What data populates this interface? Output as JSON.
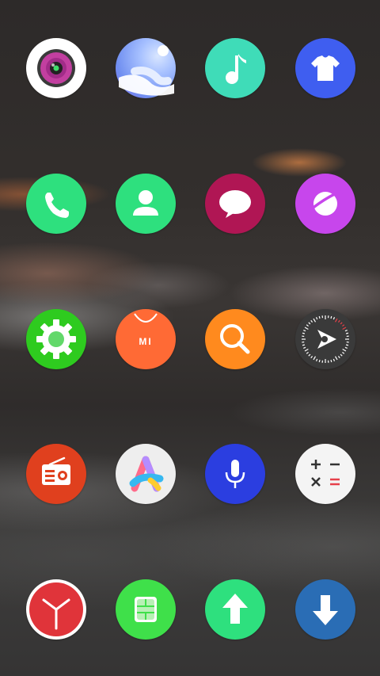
{
  "screen": "home-screen-icon-grid",
  "apps": [
    {
      "id": "camera",
      "icon": "camera-icon",
      "bg": "#ffffff"
    },
    {
      "id": "gallery",
      "icon": "gallery-icon",
      "bg": "#7fa4f5"
    },
    {
      "id": "music",
      "icon": "music-note-icon",
      "bg": "#3fdcb8"
    },
    {
      "id": "themes",
      "icon": "tshirt-icon",
      "bg": "#3f5ef0"
    },
    {
      "id": "phone",
      "icon": "phone-icon",
      "bg": "#2ee07e"
    },
    {
      "id": "contacts",
      "icon": "contact-icon",
      "bg": "#2ee07e"
    },
    {
      "id": "messages",
      "icon": "chat-bubble-icon",
      "bg": "#b01654"
    },
    {
      "id": "browser",
      "icon": "planet-icon",
      "bg": "#c746ec"
    },
    {
      "id": "settings",
      "icon": "gear-icon",
      "bg": "#2ecb1f"
    },
    {
      "id": "mi-store",
      "icon": "shopping-bag-icon",
      "bg": "#ff6a35",
      "label": "MI"
    },
    {
      "id": "search",
      "icon": "magnifier-icon",
      "bg": "#ff8a1e"
    },
    {
      "id": "compass",
      "icon": "compass-icon",
      "bg": "#3a3a3a"
    },
    {
      "id": "radio",
      "icon": "radio-icon",
      "bg": "#e0401e"
    },
    {
      "id": "app-vault",
      "icon": "app-vault-icon",
      "bg": "#eeeeee"
    },
    {
      "id": "recorder",
      "icon": "microphone-icon",
      "bg": "#2b3ee0"
    },
    {
      "id": "calculator",
      "icon": "calculator-icon",
      "bg": "#f4f4f4"
    },
    {
      "id": "clock",
      "icon": "clock-icon",
      "bg": "#e0343a"
    },
    {
      "id": "sim-toolkit",
      "icon": "sim-card-icon",
      "bg": "#3fe04a"
    },
    {
      "id": "updater",
      "icon": "arrow-up-icon",
      "bg": "#2ee07e"
    },
    {
      "id": "downloads",
      "icon": "arrow-down-icon",
      "bg": "#2a6db5"
    }
  ]
}
